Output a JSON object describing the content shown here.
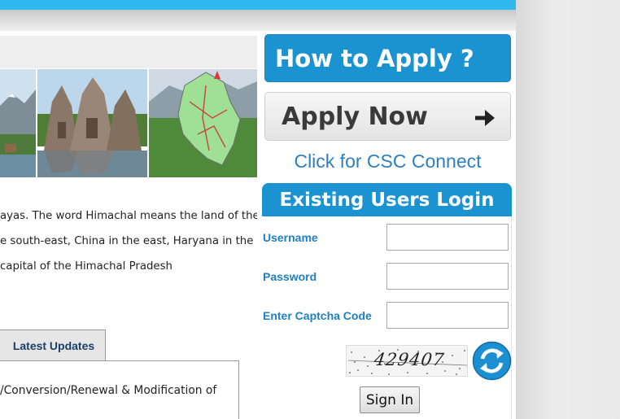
{
  "about": {
    "line1": "ayas. The word Himachal means the land of the",
    "line2": "e south-east, China in the east, Haryana in the",
    "line3": "capital of the Himachal Pradesh"
  },
  "updates": {
    "tab_label": "Latest Updates",
    "item1": "/Conversion/Renewal & Modification of"
  },
  "sidebar": {
    "how_to_apply": "How to Apply ?",
    "apply_now": "Apply Now",
    "csc_link": "Click for CSC Connect"
  },
  "login": {
    "heading": "Existing Users Login",
    "username_label": "Username",
    "username_value": "",
    "password_label": "Password",
    "password_value": "",
    "captcha_label": "Enter Captcha Code",
    "captcha_value": "",
    "captcha_image_text": "429407",
    "sign_in": "Sign In"
  },
  "colors": {
    "brand_blue": "#1b93d1",
    "top_bar": "#2fb8ee",
    "label_blue": "#1f7fbf"
  }
}
